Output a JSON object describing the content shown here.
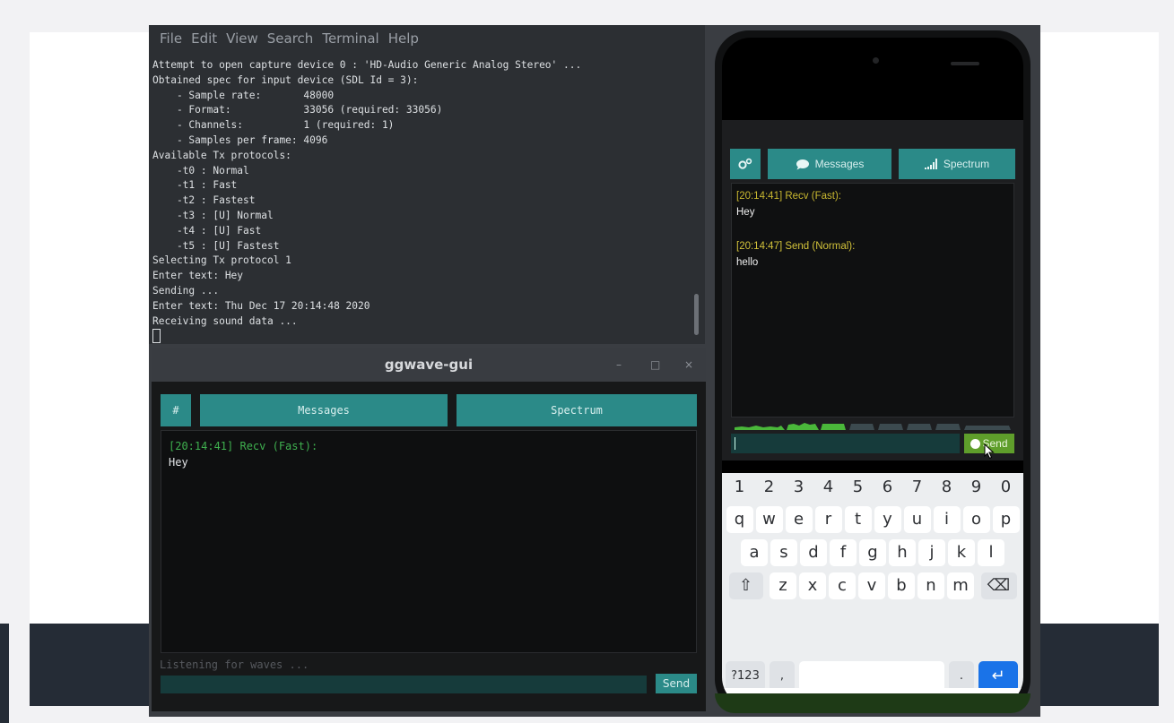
{
  "terminal": {
    "menu": [
      "File",
      "Edit",
      "View",
      "Search",
      "Terminal",
      "Help"
    ],
    "lines": [
      "Attempt to open capture device 0 : 'HD-Audio Generic Analog Stereo' ...",
      "Obtained spec for input device (SDL Id = 3):",
      "    - Sample rate:       48000",
      "    - Format:            33056 (required: 33056)",
      "    - Channels:          1 (required: 1)",
      "    - Samples per frame: 4096",
      "Available Tx protocols:",
      "    -t0 : Normal",
      "    -t1 : Fast",
      "    -t2 : Fastest",
      "    -t3 : [U] Normal",
      "    -t4 : [U] Fast",
      "    -t5 : [U] Fastest",
      "Selecting Tx protocol 1",
      "Enter text: Hey",
      "Sending ...",
      "Enter text: Thu Dec 17 20:14:48 2020",
      "Receiving sound data ..."
    ]
  },
  "gui": {
    "title": "ggwave-gui",
    "controls": {
      "minimize": "–",
      "maximize": "□",
      "close": "×"
    },
    "hash_label": "#",
    "tabs": {
      "messages": "Messages",
      "spectrum": "Spectrum"
    },
    "messages": [
      {
        "header": "[20:14:41] Recv (Fast):",
        "text": "Hey"
      }
    ],
    "status": "Listening for waves ...",
    "send_label": "Send",
    "colors": {
      "teal": "#2b8a88",
      "recv": "#3fb04f"
    }
  },
  "phone": {
    "tabs": {
      "messages": "Messages",
      "spectrum": "Spectrum"
    },
    "messages": [
      {
        "header": "[20:14:41] Recv (Fast):",
        "text": "Hey"
      },
      {
        "header": "[20:14:47] Send (Normal):",
        "text": "hello"
      }
    ],
    "send_label": "Send",
    "keyboard": {
      "numbers": [
        "1",
        "2",
        "3",
        "4",
        "5",
        "6",
        "7",
        "8",
        "9",
        "0"
      ],
      "row1": [
        "q",
        "w",
        "e",
        "r",
        "t",
        "y",
        "u",
        "i",
        "o",
        "p"
      ],
      "row2": [
        "a",
        "s",
        "d",
        "f",
        "g",
        "h",
        "j",
        "k",
        "l"
      ],
      "row3": [
        "z",
        "x",
        "c",
        "v",
        "b",
        "n",
        "m"
      ],
      "symbols_key": "?123",
      "comma_key": ",",
      "period_key": ".",
      "shift_icon": "⇧",
      "backspace_icon": "⌫",
      "enter_icon": "↵"
    },
    "colors": {
      "recv": "#c9b830",
      "send": "#d2c23a",
      "send_button": "#5f9e2b",
      "enter_key": "#1a73e8"
    }
  }
}
